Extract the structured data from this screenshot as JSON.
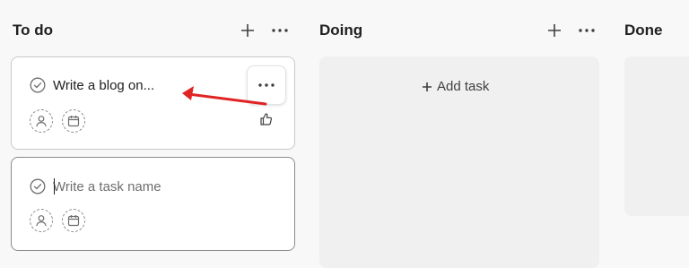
{
  "columns": [
    {
      "title": "To do"
    },
    {
      "title": "Doing",
      "add_task_label": "Add task"
    },
    {
      "title": "Done"
    }
  ],
  "cards": [
    {
      "title": "Write a blog on..."
    },
    {
      "placeholder": "Write a task name"
    }
  ],
  "annotation": {
    "arrow_color": "#e02424"
  }
}
